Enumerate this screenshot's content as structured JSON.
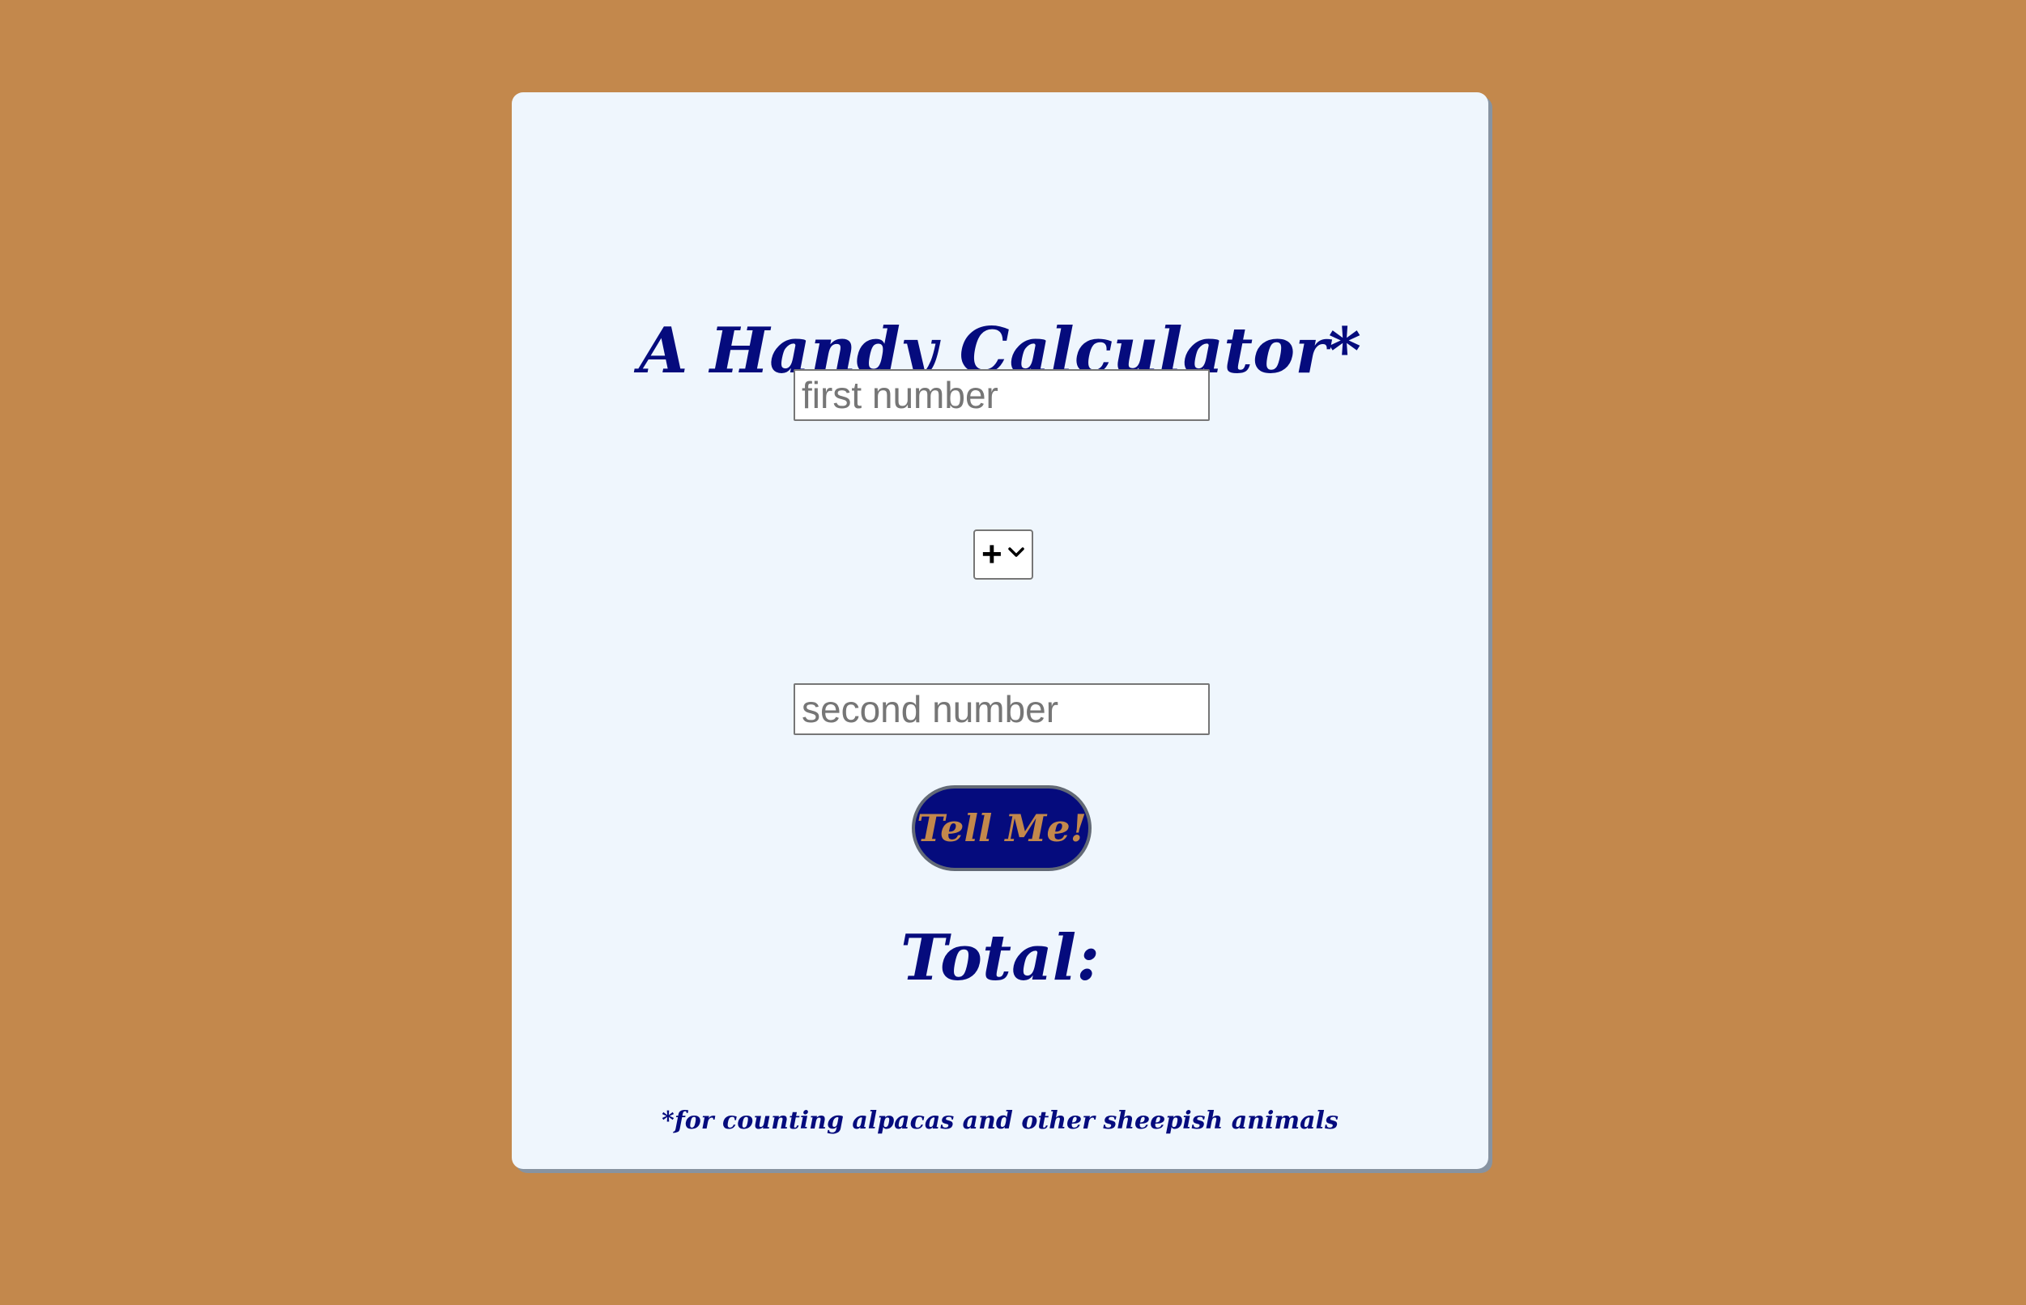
{
  "page": {
    "background_color": "#c3884c"
  },
  "card": {
    "background_color": "#eff6fd",
    "title": "A Handy Calculator*",
    "first_input": {
      "value": "",
      "placeholder": "first number"
    },
    "operator_select": {
      "selected": "+",
      "icon": "chevron-down-icon"
    },
    "second_input": {
      "value": "",
      "placeholder": "second number"
    },
    "submit_button_label": "Tell Me!",
    "total_label": "Total:",
    "footnote": "*for counting alpacas and other sheepish animals"
  },
  "colors": {
    "text": "#050b7d",
    "button_background": "#050b7d",
    "button_text": "#c3884c"
  }
}
